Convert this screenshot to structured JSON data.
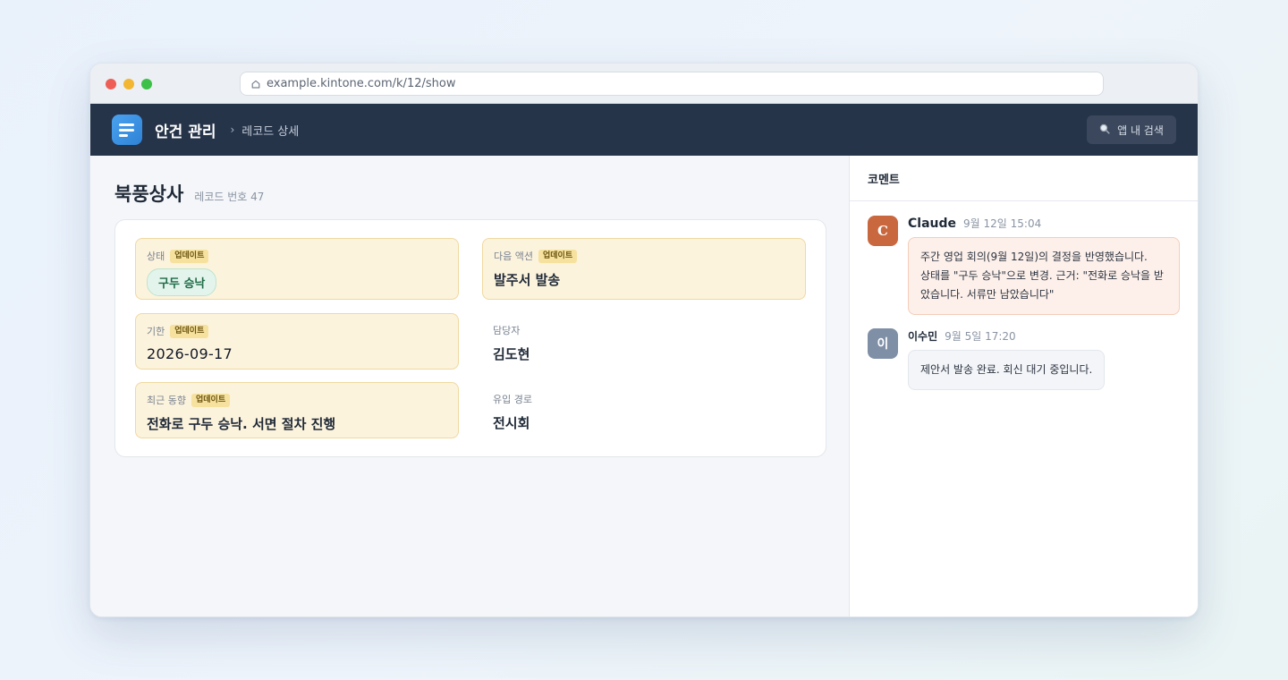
{
  "browser": {
    "url": "example.kintone.com/k/12/show"
  },
  "app": {
    "title": "안건 관리",
    "breadcrumb_separator": "›",
    "breadcrumb": "레코드 상세",
    "search_label": "앱 내 검색"
  },
  "record": {
    "name": "북풍상사",
    "number_label": "레코드 번호 47"
  },
  "fields": {
    "updated_badge": "업데이트",
    "status": {
      "label": "상태",
      "value": "구두 승낙",
      "updated": true
    },
    "next_action": {
      "label": "다음 액션",
      "value": "발주서 발송",
      "updated": true
    },
    "due_date": {
      "label": "기한",
      "value": "2026-09-17",
      "updated": true
    },
    "owner": {
      "label": "담당자",
      "value": "김도현",
      "updated": false
    },
    "recent_activity": {
      "label": "최근 동향",
      "value": "전화로 구두 승낙. 서면 절차 진행",
      "updated": true
    },
    "source": {
      "label": "유입 경로",
      "value": "전시회",
      "updated": false
    }
  },
  "comments": {
    "title": "코멘트",
    "items": [
      {
        "avatar": "C",
        "author": "Claude",
        "time": "9월 12일 15:04",
        "lines": [
          "주간 영업 회의(9월 12일)의 결정을 반영했습니다.",
          "상태를 \"구두 승낙\"으로 변경. 근거: \"전화로 승낙을 받",
          "았습니다. 서류만 남았습니다\""
        ]
      },
      {
        "avatar": "이",
        "author": "이수민",
        "time": "9월 5일 17:20",
        "text": "제안서 발송 완료. 회신 대기 중입니다."
      }
    ]
  },
  "colors": {
    "header_bg": "#26344a",
    "updated_bg": "#fcf3dd",
    "status_green": "#1e6b46",
    "claude_avatar": "#c9683f"
  }
}
